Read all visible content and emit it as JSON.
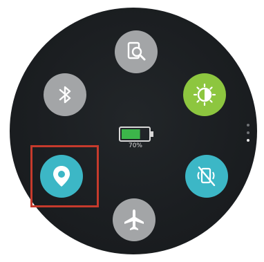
{
  "quick_panel": {
    "battery": {
      "percent_label": "70%",
      "level": 0.7
    },
    "buttons": [
      {
        "id": "find",
        "icon": "find-device-icon",
        "color": "#a3a5a7"
      },
      {
        "id": "bluetooth",
        "icon": "bluetooth-icon",
        "color": "#a3a5a7"
      },
      {
        "id": "brightness",
        "icon": "brightness-icon",
        "color": "#8dc63f"
      },
      {
        "id": "location",
        "icon": "location-pin-icon",
        "color": "#3cb7c6",
        "highlighted": true
      },
      {
        "id": "sound-off",
        "icon": "sound-off-icon",
        "color": "#3cb7c6"
      },
      {
        "id": "airplane",
        "icon": "airplane-icon",
        "color": "#a3a5a7"
      }
    ],
    "page_indicator": {
      "total": 3,
      "active": 3
    },
    "colors": {
      "face": "#1b1e21",
      "battery_fill": "#3cb54a",
      "highlight": "#c63a2c"
    }
  }
}
